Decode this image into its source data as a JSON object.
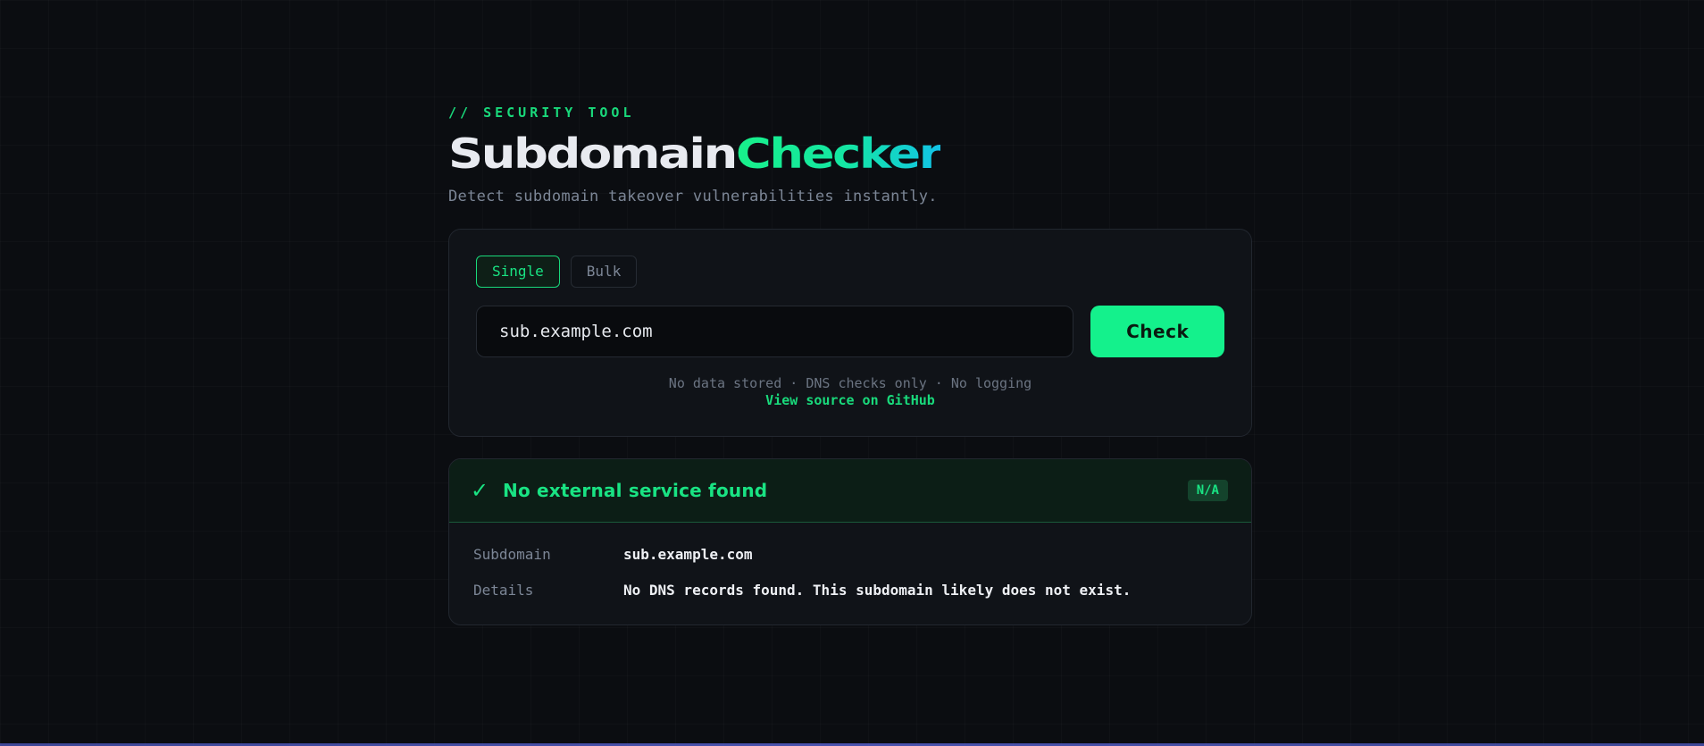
{
  "header": {
    "eyebrow": "// SECURITY TOOL",
    "title_part1": "Subdomain",
    "title_part2": "Checker",
    "subtitle": "Detect subdomain takeover vulnerabilities instantly."
  },
  "form": {
    "tabs": [
      {
        "label": "Single",
        "active": true
      },
      {
        "label": "Bulk",
        "active": false
      }
    ],
    "input_placeholder": "sub.example.com",
    "input_value": "",
    "check_label": "Check",
    "note": "No data stored · DNS checks only · No logging",
    "github_link": "View source on GitHub"
  },
  "result": {
    "icon": "check-icon",
    "icon_glyph": "✓",
    "title": "No external service found",
    "badge": "N/A",
    "rows": [
      {
        "key": "Subdomain",
        "value": "sub.example.com"
      },
      {
        "key": "Details",
        "value": "No DNS records found. This subdomain likely does not exist."
      }
    ]
  },
  "colors": {
    "accent": "#14f18c",
    "accent_text": "#19e383",
    "background": "#0b0d11",
    "card": "#101318"
  }
}
